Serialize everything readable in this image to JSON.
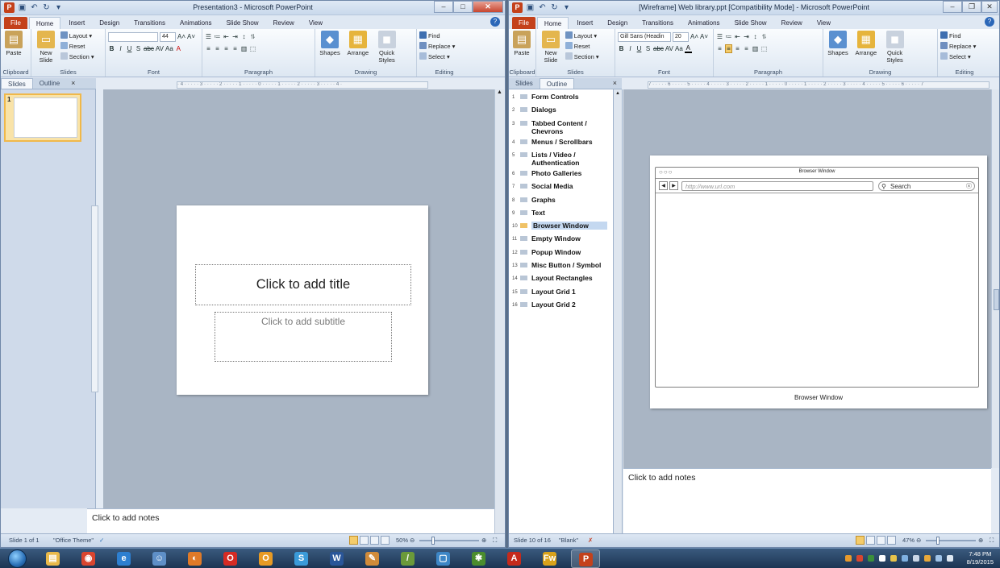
{
  "colors": {
    "file_tab": "#c4411b",
    "ribbon_bg": "#dde7f2",
    "selected_outline": "#c4d8f0",
    "canvas_bg": "#a4b0bf",
    "taskbar": "#1c3553"
  },
  "common": {
    "tabs": [
      "File",
      "Home",
      "Insert",
      "Design",
      "Transitions",
      "Animations",
      "Slide Show",
      "Review",
      "View"
    ],
    "groups": {
      "clipboard": "Clipboard",
      "slides": "Slides",
      "font": "Font",
      "paragraph": "Paragraph",
      "drawing": "Drawing",
      "editing": "Editing"
    },
    "buttons": {
      "paste": "Paste",
      "new_slide": "New Slide",
      "layout": "Layout",
      "reset": "Reset",
      "section": "Section",
      "shapes": "Shapes",
      "arrange": "Arrange",
      "quick_styles": "Quick Styles",
      "find": "Find",
      "replace": "Replace",
      "select": "Select"
    },
    "font_format_btns": [
      "B",
      "I",
      "U",
      "S",
      "abc",
      "AV",
      "Aa"
    ],
    "pane_tabs": {
      "slides": "Slides",
      "outline": "Outline",
      "close": "×"
    },
    "notes_placeholder": "Click to add notes"
  },
  "window1": {
    "title": "Presentation3 - Microsoft PowerPoint",
    "font_name": "",
    "font_size": "44",
    "thumb_number": "1",
    "title_placeholder": "Click to add title",
    "subtitle_placeholder": "Click to add subtitle",
    "status": {
      "slide": "Slide 1 of 1",
      "theme": "\"Office Theme\"",
      "zoom": "50%"
    }
  },
  "window2": {
    "title": "[Wireframe] Web library.ppt [Compatibility Mode] - Microsoft PowerPoint",
    "font_name": "Gill Sans (Headin",
    "font_size": "20",
    "outline_items": [
      {
        "num": "1",
        "label": "Form Controls"
      },
      {
        "num": "2",
        "label": "Dialogs"
      },
      {
        "num": "3",
        "label": "Tabbed Content / Chevrons"
      },
      {
        "num": "4",
        "label": "Menus / Scrollbars"
      },
      {
        "num": "5",
        "label": "Lists / Video / Authentication"
      },
      {
        "num": "6",
        "label": "Photo Galleries"
      },
      {
        "num": "7",
        "label": "Social Media"
      },
      {
        "num": "8",
        "label": "Graphs"
      },
      {
        "num": "9",
        "label": "Text"
      },
      {
        "num": "10",
        "label": "Browser Window",
        "selected": true
      },
      {
        "num": "11",
        "label": "Empty Window"
      },
      {
        "num": "12",
        "label": "Popup Window"
      },
      {
        "num": "13",
        "label": "Misc Button / Symbol"
      },
      {
        "num": "14",
        "label": "Layout Rectangles"
      },
      {
        "num": "15",
        "label": "Layout Grid 1"
      },
      {
        "num": "16",
        "label": "Layout Grid 2"
      }
    ],
    "browser": {
      "title": "Browser Window",
      "url_placeholder": "http://www.url.com",
      "search_placeholder": "Search",
      "caption": "Browser Window"
    },
    "status": {
      "slide": "Slide 10 of 16",
      "theme": "\"Blank\"",
      "zoom": "47%"
    }
  },
  "taskbar": {
    "apps": [
      {
        "name": "folder",
        "color": "#e9b94a",
        "glyph": "▤"
      },
      {
        "name": "chrome",
        "color": "#d9452f",
        "glyph": "◉"
      },
      {
        "name": "ie",
        "color": "#2d7fd1",
        "glyph": "e"
      },
      {
        "name": "user",
        "color": "#5e8fc7",
        "glyph": "☺"
      },
      {
        "name": "firefox",
        "color": "#e07a28",
        "glyph": "◐"
      },
      {
        "name": "opera",
        "color": "#d52b24",
        "glyph": "O"
      },
      {
        "name": "outlook",
        "color": "#e79a24",
        "glyph": "O"
      },
      {
        "name": "skype",
        "color": "#3a9ad9",
        "glyph": "S"
      },
      {
        "name": "word",
        "color": "#2a5699",
        "glyph": "W"
      },
      {
        "name": "paint",
        "color": "#d08b3a",
        "glyph": "✎"
      },
      {
        "name": "pen",
        "color": "#6b9a3a",
        "glyph": "/"
      },
      {
        "name": "window",
        "color": "#3d86c6",
        "glyph": "▢"
      },
      {
        "name": "bug",
        "color": "#4b8d2e",
        "glyph": "✱"
      },
      {
        "name": "acrobat",
        "color": "#c52a1c",
        "glyph": "A"
      },
      {
        "name": "fireworks",
        "color": "#d9a21a",
        "glyph": "Fw"
      },
      {
        "name": "powerpoint",
        "color": "#c4411b",
        "glyph": "P",
        "active": true
      }
    ],
    "time": "7:48 PM",
    "date": "8/19/2015"
  }
}
